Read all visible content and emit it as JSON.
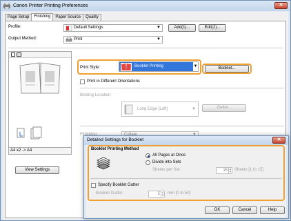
{
  "window": {
    "title": "Canon Printer Printing Preferences",
    "close_glyph": "✕"
  },
  "tabs": [
    "Page Setup",
    "Finishing",
    "Paper Source",
    "Quality"
  ],
  "profile": {
    "label": "Profile:",
    "value": "Default Settings",
    "add_label": "Add(1)...",
    "edit_label": "Edit(2)..."
  },
  "output_method": {
    "label": "Output Method:",
    "value": "Print"
  },
  "preview": {
    "caption": "A4 x2 -> A4",
    "view_settings_label": "View Settings"
  },
  "print_style": {
    "label": "Print Style:",
    "value": "Booklet Printing",
    "booklet_label": "Booklet..."
  },
  "print_different_orientations": "Print in Different Orientations",
  "binding_location": {
    "label": "Binding Location:",
    "value": "Long Edge [Left]",
    "gutter_label": "Gutter..."
  },
  "finishing": {
    "label": "Finishing:",
    "value": "Collate"
  },
  "dialog": {
    "title": "Detailed Settings for Booklet",
    "group_label": "Booklet Printing Method",
    "opt_all": "All Pages at Once",
    "opt_divide": "Divide into Sets",
    "sheets_per_set_label": "Sheets per Set:",
    "sheets_per_set_value": "15",
    "sheets_range": "Sheets [1 to 15]",
    "specify_gutter_label": "Specify Booklet Gutter",
    "booklet_gutter_label": "Booklet Gutter:",
    "booklet_gutter_value": "5",
    "gutter_range": "mm [0 to 50]",
    "ok_label": "OK",
    "cancel_label": "Cancel",
    "help_label": "Help"
  },
  "colors": {
    "highlight_orange": "#f0a030",
    "selection_blue": "#3377dd"
  }
}
